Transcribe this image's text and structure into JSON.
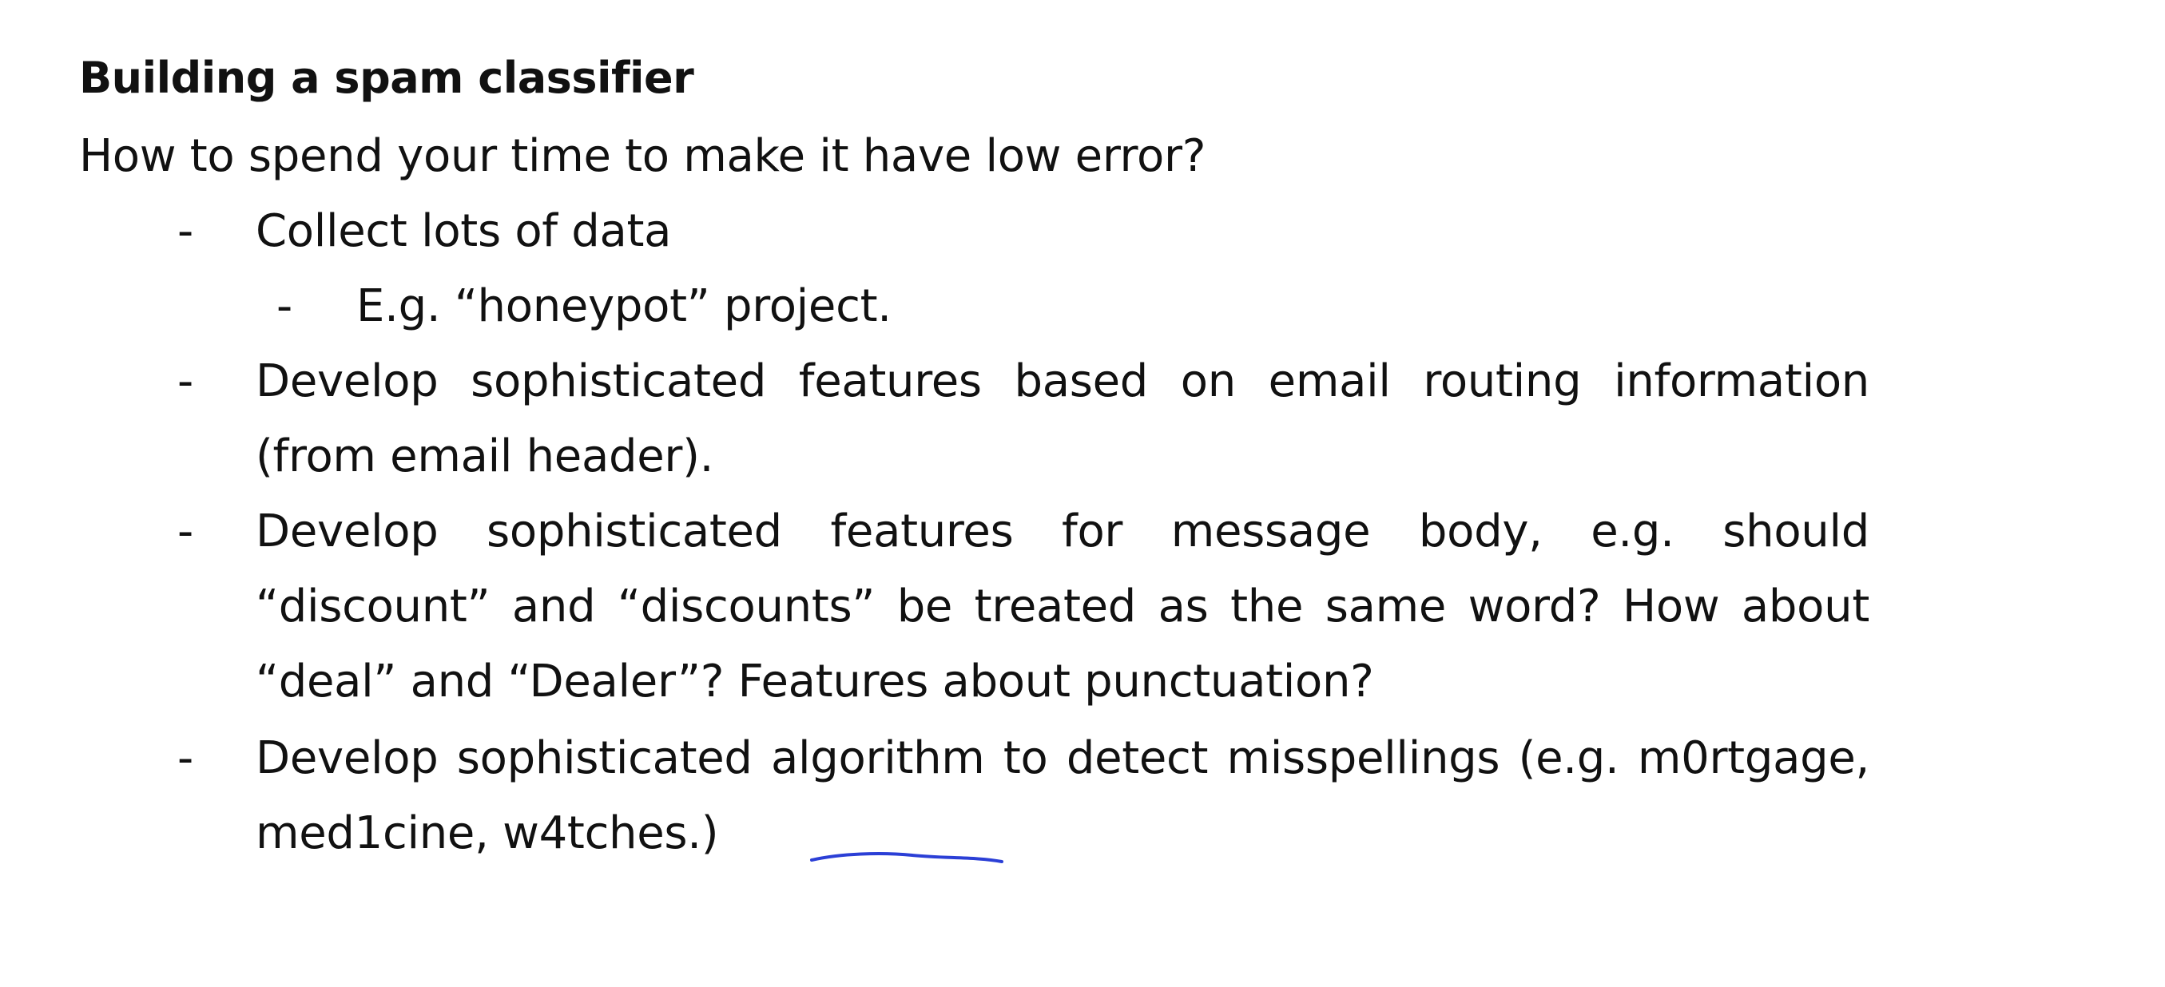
{
  "slide": {
    "title": "Building a spam classifier",
    "subtitle": "How to spend your time to make it have low error?",
    "bullet_symbol": "-",
    "items": [
      {
        "text": "Collect lots of data"
      },
      {
        "text": "E.g. “honeypot” project."
      },
      {
        "text": "Develop sophisticated features based on email routing information (from email header)."
      },
      {
        "text": "Develop sophisticated features for message body, e.g. should “discount” and “discounts” be treated as the same word? How about “deal” and “Dealer”? Features about punctuation?"
      },
      {
        "text_before": "Develop sophisticated algorithm to detect misspellings (e.g. m0rtgage, med1cine, ",
        "underlined_word": "w4tches",
        "text_after": ".)"
      }
    ],
    "annotation_color": "#2b3fd6"
  }
}
